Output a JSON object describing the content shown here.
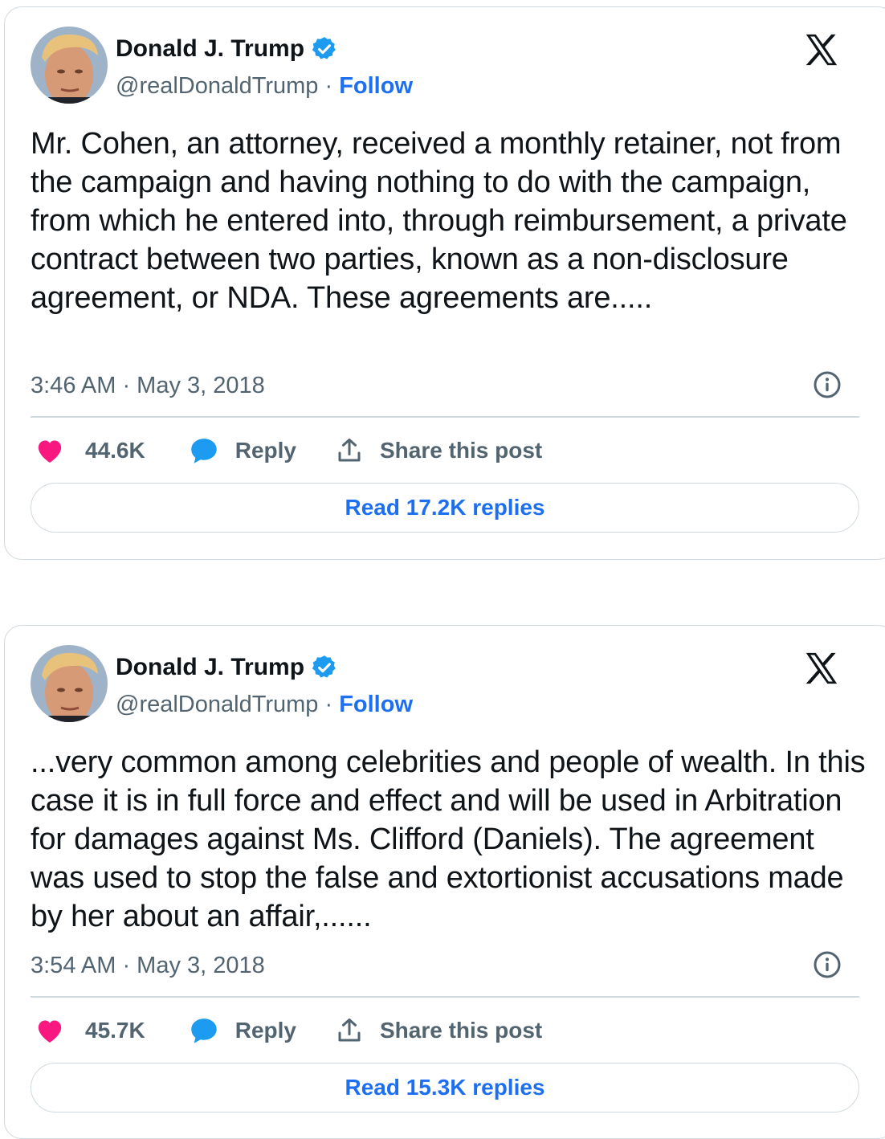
{
  "tweets": [
    {
      "author_name": "Donald J. Trump",
      "handle": "@realDonaldTrump",
      "separator": " · ",
      "follow_label": "Follow",
      "text": "Mr. Cohen, an attorney, received a monthly retainer, not from the campaign and having nothing to do with the campaign, from which he entered into, through reimbursement, a private contract between two parties, known as a non-disclosure agreement, or NDA. These agreements are.....",
      "timestamp": "3:46 AM · May 3, 2018",
      "likes": "44.6K",
      "reply_label": "Reply",
      "share_label": "Share this post",
      "read_replies_label": "Read 17.2K replies"
    },
    {
      "author_name": "Donald J. Trump",
      "handle": "@realDonaldTrump",
      "separator": " · ",
      "follow_label": "Follow",
      "text": "...very common among celebrities and people of wealth. In this case it is in full force and effect and will be used in Arbitration for damages against Ms. Clifford (Daniels). The agreement was used to stop the false and extortionist accusations made by her about an affair,......",
      "timestamp": "3:54 AM · May 3, 2018",
      "likes": "45.7K",
      "reply_label": "Reply",
      "share_label": "Share this post",
      "read_replies_label": "Read 15.3K replies"
    }
  ],
  "icons": {
    "brand": "x-logo-icon",
    "verified": "verified-badge-icon",
    "like": "heart-icon",
    "reply": "speech-bubble-icon",
    "share": "share-upload-icon",
    "info": "info-icon"
  },
  "colors": {
    "like": "#f91880",
    "reply": "#1d9bf0",
    "link": "#1d6ff2",
    "verified": "#1d9bf0",
    "secondary_text": "#536471",
    "border": "#cfd9de"
  }
}
